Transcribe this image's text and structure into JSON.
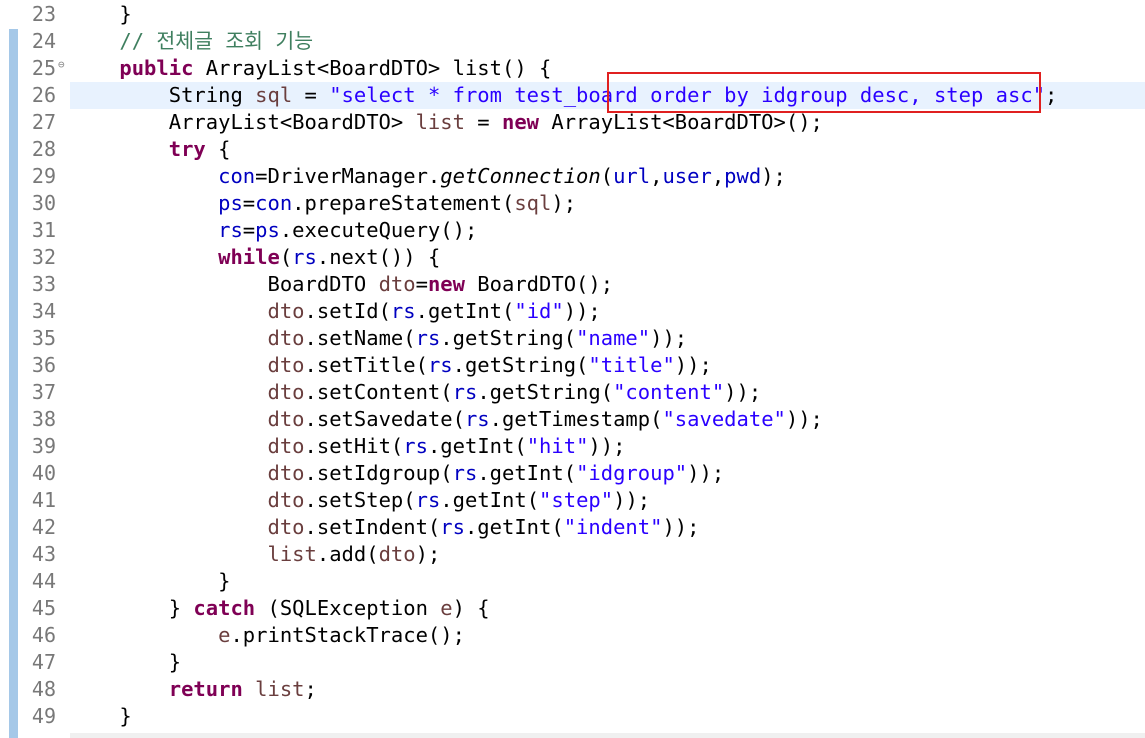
{
  "editor": {
    "line_numbers": [
      "23",
      "24",
      "25",
      "26",
      "27",
      "28",
      "29",
      "30",
      "31",
      "32",
      "33",
      "34",
      "35",
      "36",
      "37",
      "38",
      "39",
      "40",
      "41",
      "42",
      "43",
      "44",
      "45",
      "46",
      "47",
      "48",
      "49"
    ],
    "fold_marker": "⊖",
    "lines": [
      [
        {
          "t": "    }",
          "c": ""
        }
      ],
      [
        {
          "t": "    // 전체글 조회 기능",
          "c": "cmt"
        }
      ],
      [
        {
          "t": "    ",
          "c": ""
        },
        {
          "t": "public",
          "c": "kw"
        },
        {
          "t": " ArrayList<BoardDTO> list() {",
          "c": ""
        }
      ],
      [
        {
          "t": "        String ",
          "c": ""
        },
        {
          "t": "sql",
          "c": "loc"
        },
        {
          "t": " = ",
          "c": ""
        },
        {
          "t": "\"select * from test_board order by idgroup desc, step asc\"",
          "c": "str"
        },
        {
          "t": ";",
          "c": ""
        }
      ],
      [
        {
          "t": "        ArrayList<BoardDTO> ",
          "c": ""
        },
        {
          "t": "list",
          "c": "loc"
        },
        {
          "t": " = ",
          "c": ""
        },
        {
          "t": "new",
          "c": "kw"
        },
        {
          "t": " ArrayList<BoardDTO>();",
          "c": ""
        }
      ],
      [
        {
          "t": "        ",
          "c": ""
        },
        {
          "t": "try",
          "c": "kw"
        },
        {
          "t": " {",
          "c": ""
        }
      ],
      [
        {
          "t": "            ",
          "c": ""
        },
        {
          "t": "con",
          "c": "fld"
        },
        {
          "t": "=DriverManager.",
          "c": ""
        },
        {
          "t": "getConnection",
          "c": "static"
        },
        {
          "t": "(",
          "c": ""
        },
        {
          "t": "url",
          "c": "fld"
        },
        {
          "t": ",",
          "c": ""
        },
        {
          "t": "user",
          "c": "fld"
        },
        {
          "t": ",",
          "c": ""
        },
        {
          "t": "pwd",
          "c": "fld"
        },
        {
          "t": ");",
          "c": ""
        }
      ],
      [
        {
          "t": "            ",
          "c": ""
        },
        {
          "t": "ps",
          "c": "fld"
        },
        {
          "t": "=",
          "c": ""
        },
        {
          "t": "con",
          "c": "fld"
        },
        {
          "t": ".prepareStatement(",
          "c": ""
        },
        {
          "t": "sql",
          "c": "loc"
        },
        {
          "t": ");",
          "c": ""
        }
      ],
      [
        {
          "t": "            ",
          "c": ""
        },
        {
          "t": "rs",
          "c": "fld"
        },
        {
          "t": "=",
          "c": ""
        },
        {
          "t": "ps",
          "c": "fld"
        },
        {
          "t": ".executeQuery();",
          "c": ""
        }
      ],
      [
        {
          "t": "            ",
          "c": ""
        },
        {
          "t": "while",
          "c": "kw"
        },
        {
          "t": "(",
          "c": ""
        },
        {
          "t": "rs",
          "c": "fld"
        },
        {
          "t": ".next()) {",
          "c": ""
        }
      ],
      [
        {
          "t": "                BoardDTO ",
          "c": ""
        },
        {
          "t": "dto",
          "c": "loc"
        },
        {
          "t": "=",
          "c": ""
        },
        {
          "t": "new",
          "c": "kw"
        },
        {
          "t": " BoardDTO();",
          "c": ""
        }
      ],
      [
        {
          "t": "                ",
          "c": ""
        },
        {
          "t": "dto",
          "c": "loc"
        },
        {
          "t": ".setId(",
          "c": ""
        },
        {
          "t": "rs",
          "c": "fld"
        },
        {
          "t": ".getInt(",
          "c": ""
        },
        {
          "t": "\"id\"",
          "c": "str"
        },
        {
          "t": "));",
          "c": ""
        }
      ],
      [
        {
          "t": "                ",
          "c": ""
        },
        {
          "t": "dto",
          "c": "loc"
        },
        {
          "t": ".setName(",
          "c": ""
        },
        {
          "t": "rs",
          "c": "fld"
        },
        {
          "t": ".getString(",
          "c": ""
        },
        {
          "t": "\"name\"",
          "c": "str"
        },
        {
          "t": "));",
          "c": ""
        }
      ],
      [
        {
          "t": "                ",
          "c": ""
        },
        {
          "t": "dto",
          "c": "loc"
        },
        {
          "t": ".setTitle(",
          "c": ""
        },
        {
          "t": "rs",
          "c": "fld"
        },
        {
          "t": ".getString(",
          "c": ""
        },
        {
          "t": "\"title\"",
          "c": "str"
        },
        {
          "t": "));",
          "c": ""
        }
      ],
      [
        {
          "t": "                ",
          "c": ""
        },
        {
          "t": "dto",
          "c": "loc"
        },
        {
          "t": ".setContent(",
          "c": ""
        },
        {
          "t": "rs",
          "c": "fld"
        },
        {
          "t": ".getString(",
          "c": ""
        },
        {
          "t": "\"content\"",
          "c": "str"
        },
        {
          "t": "));",
          "c": ""
        }
      ],
      [
        {
          "t": "                ",
          "c": ""
        },
        {
          "t": "dto",
          "c": "loc"
        },
        {
          "t": ".setSavedate(",
          "c": ""
        },
        {
          "t": "rs",
          "c": "fld"
        },
        {
          "t": ".getTimestamp(",
          "c": ""
        },
        {
          "t": "\"savedate\"",
          "c": "str"
        },
        {
          "t": "));",
          "c": ""
        }
      ],
      [
        {
          "t": "                ",
          "c": ""
        },
        {
          "t": "dto",
          "c": "loc"
        },
        {
          "t": ".setHit(",
          "c": ""
        },
        {
          "t": "rs",
          "c": "fld"
        },
        {
          "t": ".getInt(",
          "c": ""
        },
        {
          "t": "\"hit\"",
          "c": "str"
        },
        {
          "t": "));",
          "c": ""
        }
      ],
      [
        {
          "t": "                ",
          "c": ""
        },
        {
          "t": "dto",
          "c": "loc"
        },
        {
          "t": ".setIdgroup(",
          "c": ""
        },
        {
          "t": "rs",
          "c": "fld"
        },
        {
          "t": ".getInt(",
          "c": ""
        },
        {
          "t": "\"idgroup\"",
          "c": "str"
        },
        {
          "t": "));",
          "c": ""
        }
      ],
      [
        {
          "t": "                ",
          "c": ""
        },
        {
          "t": "dto",
          "c": "loc"
        },
        {
          "t": ".setStep(",
          "c": ""
        },
        {
          "t": "rs",
          "c": "fld"
        },
        {
          "t": ".getInt(",
          "c": ""
        },
        {
          "t": "\"step\"",
          "c": "str"
        },
        {
          "t": "));",
          "c": ""
        }
      ],
      [
        {
          "t": "                ",
          "c": ""
        },
        {
          "t": "dto",
          "c": "loc"
        },
        {
          "t": ".setIndent(",
          "c": ""
        },
        {
          "t": "rs",
          "c": "fld"
        },
        {
          "t": ".getInt(",
          "c": ""
        },
        {
          "t": "\"indent\"",
          "c": "str"
        },
        {
          "t": "));",
          "c": ""
        }
      ],
      [
        {
          "t": "                ",
          "c": ""
        },
        {
          "t": "list",
          "c": "loc"
        },
        {
          "t": ".add(",
          "c": ""
        },
        {
          "t": "dto",
          "c": "loc"
        },
        {
          "t": ");",
          "c": ""
        }
      ],
      [
        {
          "t": "            }",
          "c": ""
        }
      ],
      [
        {
          "t": "        } ",
          "c": ""
        },
        {
          "t": "catch",
          "c": "kw"
        },
        {
          "t": " (SQLException ",
          "c": ""
        },
        {
          "t": "e",
          "c": "loc"
        },
        {
          "t": ") {",
          "c": ""
        }
      ],
      [
        {
          "t": "            ",
          "c": ""
        },
        {
          "t": "e",
          "c": "loc"
        },
        {
          "t": ".printStackTrace();",
          "c": ""
        }
      ],
      [
        {
          "t": "        }",
          "c": ""
        }
      ],
      [
        {
          "t": "        ",
          "c": ""
        },
        {
          "t": "return",
          "c": "kw"
        },
        {
          "t": " ",
          "c": ""
        },
        {
          "t": "list",
          "c": "loc"
        },
        {
          "t": ";",
          "c": ""
        }
      ],
      [
        {
          "t": "    }",
          "c": ""
        }
      ]
    ],
    "current_line_index": 3,
    "fold_line_index": 2
  },
  "colors": {
    "keyword": "#7f0055",
    "string": "#2a00ff",
    "comment": "#3f7f5f",
    "field": "#0000c0",
    "local": "#6a3e3e",
    "current_line": "#e8f2fe",
    "highlight_box": "#e02020"
  }
}
